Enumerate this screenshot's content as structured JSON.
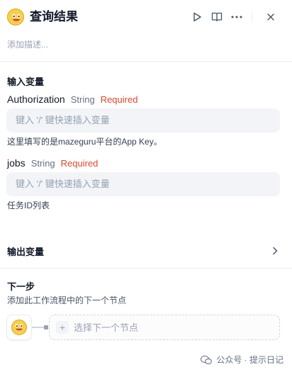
{
  "header": {
    "title": "查询结果",
    "node_icon": "emoji-face-icon",
    "actions": [
      "play-icon",
      "book-icon",
      "more-icon",
      "close-icon"
    ]
  },
  "description": {
    "placeholder": "添加描述..."
  },
  "inputs": {
    "section_title": "输入变量",
    "variables": [
      {
        "name": "Authorization",
        "type": "String",
        "required": "Required",
        "placeholder": "键入 '/' 键快速插入变量",
        "hint": "这里填写的是mazeguru平台的App Key。"
      },
      {
        "name": "jobs",
        "type": "String",
        "required": "Required",
        "placeholder": "键入 '/' 键快速插入变量",
        "hint": "任务ID列表"
      }
    ]
  },
  "outputs": {
    "section_title": "输出变量"
  },
  "next_step": {
    "title": "下一步",
    "subtitle": "添加此工作流程中的下一个节点",
    "select_label": "选择下一个节点"
  },
  "watermark": {
    "text": "公众号 · 提示日记"
  },
  "colors": {
    "required": "#e0452b",
    "accent_face": "#f8cf4a"
  }
}
